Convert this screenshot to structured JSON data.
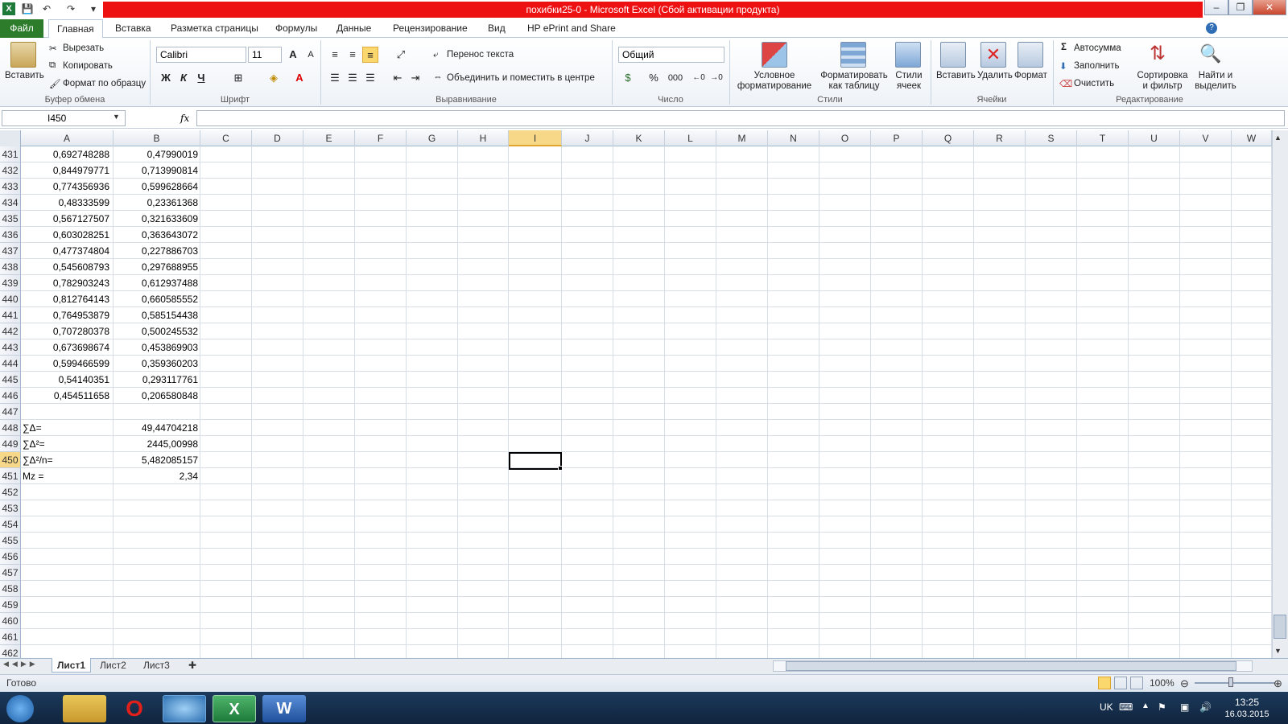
{
  "window": {
    "title": "похибки25-0  -  Microsoft Excel (Сбой активации продукта)",
    "app_icon": "excel-icon",
    "controls": [
      "minimize-icon",
      "restore-icon",
      "close-icon"
    ]
  },
  "tabs": [
    "Файл",
    "Главная",
    "Вставка",
    "Разметка страницы",
    "Формулы",
    "Данные",
    "Рецензирование",
    "Вид",
    "HP ePrint and Share"
  ],
  "ribbon": {
    "clipboard": {
      "label": "Буфер обмена",
      "paste": "Вставить",
      "cut": "Вырезать",
      "copy": "Копировать",
      "format_painter": "Формат по образцу"
    },
    "font": {
      "label": "Шрифт",
      "name": "Calibri",
      "size": "11",
      "bold": "Ж",
      "italic": "К",
      "underline": "Ч"
    },
    "alignment": {
      "label": "Выравнивание",
      "wrap": "Перенос текста",
      "merge": "Объединить и поместить в центре"
    },
    "number": {
      "label": "Число",
      "format": "Общий",
      "percent": "%",
      "thousands": "000"
    },
    "styles": {
      "label": "Стили",
      "conditional_1": "Условное",
      "conditional_2": "форматирование",
      "table_1": "Форматировать",
      "table_2": "как таблицу",
      "cell_1": "Стили",
      "cell_2": "ячеек"
    },
    "cells": {
      "label": "Ячейки",
      "insert": "Вставить",
      "delete": "Удалить",
      "format": "Формат"
    },
    "editing": {
      "label": "Редактирование",
      "autosum": "Автосумма",
      "fill": "Заполнить",
      "clear": "Очистить",
      "sort_1": "Сортировка",
      "sort_2": "и фильтр",
      "find_1": "Найти и",
      "find_2": "выделить"
    }
  },
  "formula_bar": {
    "name_box": "I450",
    "fx": "fx",
    "formula": ""
  },
  "columns": [
    "A",
    "B",
    "C",
    "D",
    "E",
    "F",
    "G",
    "H",
    "I",
    "J",
    "K",
    "L",
    "M",
    "N",
    "O",
    "P",
    "Q",
    "R",
    "S",
    "T",
    "U",
    "V",
    "W"
  ],
  "selected_column": "I",
  "selected_row": "450",
  "rows": [
    {
      "n": "431",
      "a": "0,692748288",
      "b": "0,47990019"
    },
    {
      "n": "432",
      "a": "0,844979771",
      "b": "0,713990814"
    },
    {
      "n": "433",
      "a": "0,774356936",
      "b": "0,599628664"
    },
    {
      "n": "434",
      "a": "0,48333599",
      "b": "0,23361368"
    },
    {
      "n": "435",
      "a": "0,567127507",
      "b": "0,321633609"
    },
    {
      "n": "436",
      "a": "0,603028251",
      "b": "0,363643072"
    },
    {
      "n": "437",
      "a": "0,477374804",
      "b": "0,227886703"
    },
    {
      "n": "438",
      "a": "0,545608793",
      "b": "0,297688955"
    },
    {
      "n": "439",
      "a": "0,782903243",
      "b": "0,612937488"
    },
    {
      "n": "440",
      "a": "0,812764143",
      "b": "0,660585552"
    },
    {
      "n": "441",
      "a": "0,764953879",
      "b": "0,585154438"
    },
    {
      "n": "442",
      "a": "0,707280378",
      "b": "0,500245532"
    },
    {
      "n": "443",
      "a": "0,673698674",
      "b": "0,453869903"
    },
    {
      "n": "444",
      "a": "0,599466599",
      "b": "0,359360203"
    },
    {
      "n": "445",
      "a": "0,54140351",
      "b": "0,293117761"
    },
    {
      "n": "446",
      "a": "0,454511658",
      "b": "0,206580848"
    },
    {
      "n": "447",
      "a": "",
      "b": ""
    },
    {
      "n": "448",
      "a": "∑Δ=",
      "b": "49,44704218",
      "label": true
    },
    {
      "n": "449",
      "a": "∑Δ²=",
      "b": "2445,00998",
      "label": true
    },
    {
      "n": "450",
      "a": "∑Δ²/n=",
      "b": "5,482085157",
      "label": true
    },
    {
      "n": "451",
      "a": "Mz =",
      "b": "2,34",
      "label": true
    },
    {
      "n": "452",
      "a": "",
      "b": ""
    },
    {
      "n": "453",
      "a": "",
      "b": ""
    },
    {
      "n": "454",
      "a": "",
      "b": ""
    },
    {
      "n": "455",
      "a": "",
      "b": ""
    },
    {
      "n": "456",
      "a": "",
      "b": ""
    },
    {
      "n": "457",
      "a": "",
      "b": ""
    },
    {
      "n": "458",
      "a": "",
      "b": ""
    },
    {
      "n": "459",
      "a": "",
      "b": ""
    },
    {
      "n": "460",
      "a": "",
      "b": ""
    },
    {
      "n": "461",
      "a": "",
      "b": ""
    },
    {
      "n": "462",
      "a": "",
      "b": ""
    }
  ],
  "sheets": [
    "Лист1",
    "Лист2",
    "Лист3"
  ],
  "active_sheet": "Лист1",
  "status": {
    "ready": "Готово",
    "zoom": "100%"
  },
  "taskbar": {
    "lang": "UK",
    "time": "13:25",
    "date": "16.03.2015"
  },
  "colors": {
    "title_red": "#ee1111",
    "file_tab": "#2c7c2c",
    "selection_header": "#f7d889",
    "taskbar": "#1c3a5c"
  }
}
